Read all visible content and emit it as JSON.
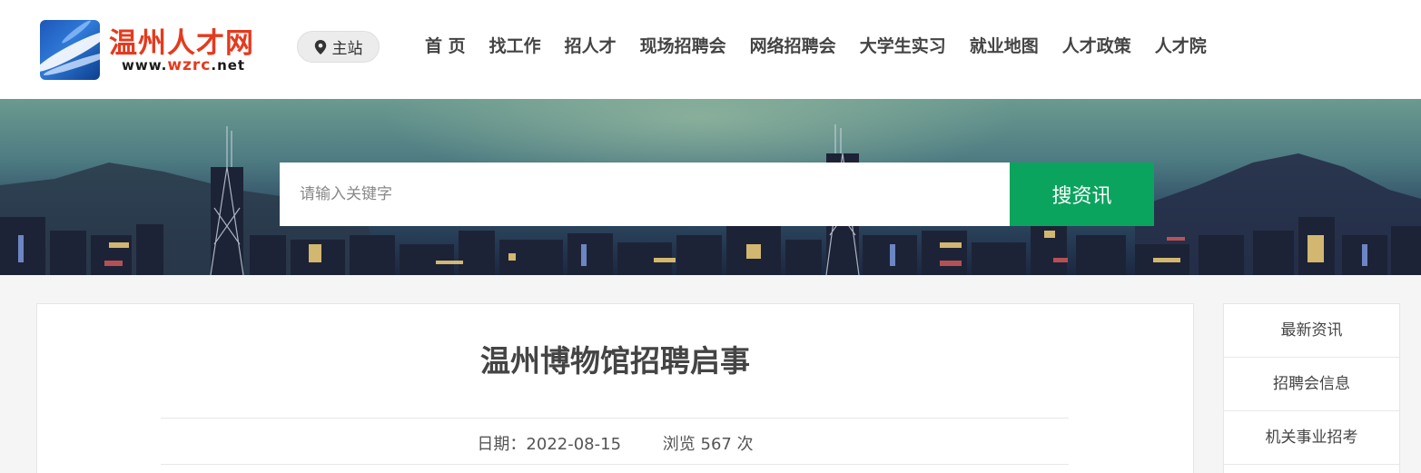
{
  "header": {
    "logo_title": "温州人才网",
    "logo_url_prefix": "www.",
    "logo_url_highlight": "wzrc",
    "logo_url_suffix": ".net",
    "site_switch_label": "主站",
    "site_switch_icon": "location-pin-icon",
    "nav": [
      "首 页",
      "找工作",
      "招人才",
      "现场招聘会",
      "网络招聘会",
      "大学生实习",
      "就业地图",
      "人才政策",
      "人才院"
    ]
  },
  "search": {
    "placeholder": "请输入关键字",
    "button_label": "搜资讯"
  },
  "article": {
    "title": "温州博物馆招聘启事",
    "date": "日期：2022-08-15",
    "views": "浏览 567 次"
  },
  "sidebar": {
    "items": [
      "最新资讯",
      "招聘会信息",
      "机关事业招考"
    ]
  },
  "colors": {
    "brand_red": "#e53a1e",
    "search_button_green": "#0aa45e",
    "logo_blue": "#1e57b8"
  }
}
